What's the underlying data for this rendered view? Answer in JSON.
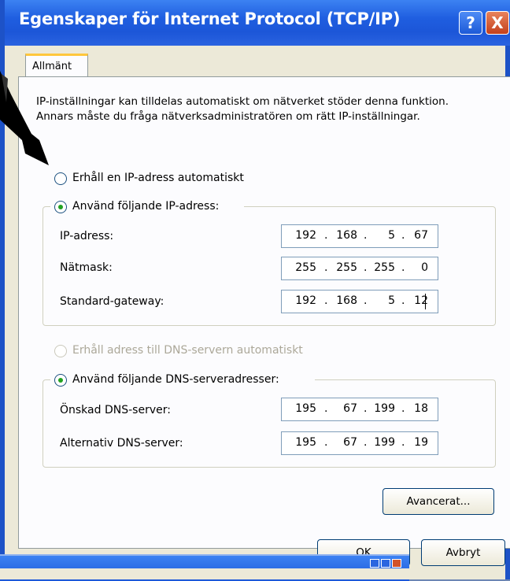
{
  "window": {
    "title": "Egenskaper för Internet Protocol (TCP/IP)",
    "help_label": "?",
    "close_label": "X"
  },
  "tabs": [
    {
      "label": "Allmänt"
    }
  ],
  "description": "IP-inställningar kan tilldelas automatiskt om nätverket stöder denna funktion. Annars måste du fråga nätverksadministratören om rätt IP-inställningar.",
  "ip_mode": {
    "auto_label": "Erhåll en IP-adress automatiskt",
    "manual_label": "Använd följande IP-adress:",
    "selected": "manual"
  },
  "ip_fields": [
    {
      "label": "IP-adress:",
      "octets": [
        "192",
        "168",
        "5",
        "67"
      ]
    },
    {
      "label": "Nätmask:",
      "octets": [
        "255",
        "255",
        "255",
        "0"
      ]
    },
    {
      "label": "Standard-gateway:",
      "octets": [
        "192",
        "168",
        "5",
        "12"
      ]
    }
  ],
  "dns_mode": {
    "auto_label": "Erhåll adress till DNS-servern automatiskt",
    "manual_label": "Använd följande DNS-serveradresser:",
    "selected": "manual",
    "auto_disabled": true
  },
  "dns_fields": [
    {
      "label": "Önskad DNS-server:",
      "octets": [
        "195",
        "67",
        "199",
        "18"
      ]
    },
    {
      "label": "Alternativ DNS-server:",
      "octets": [
        "195",
        "67",
        "199",
        "19"
      ]
    }
  ],
  "buttons": {
    "advanced": "Avancerat...",
    "ok": "OK",
    "cancel": "Avbryt"
  },
  "colors": {
    "titlebar": "#1f5ee0",
    "dialog_bg": "#ece9d8",
    "radio_selected": "#21a121"
  }
}
